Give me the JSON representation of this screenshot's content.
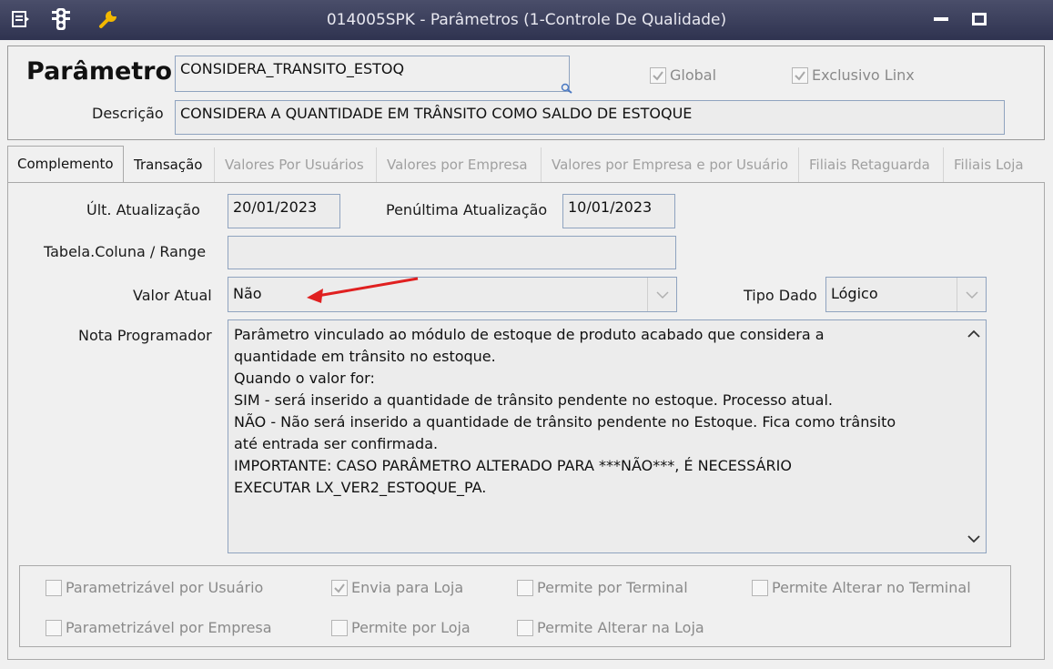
{
  "window": {
    "title": "014005SPK - Parâmetros (1-Controle De Qualidade)"
  },
  "header": {
    "param_label": "Parâmetro",
    "param_value": "CONSIDERA_TRANSITO_ESTOQ",
    "desc_label": "Descrição",
    "desc_value": "CONSIDERA A QUANTIDADE EM TRÂNSITO COMO SALDO DE ESTOQUE",
    "global_label": "Global",
    "global_checked": true,
    "exclusivo_label": "Exclusivo Linx",
    "exclusivo_checked": true
  },
  "tabs": [
    {
      "label": "Complemento",
      "state": "active"
    },
    {
      "label": "Transação",
      "state": "enabled"
    },
    {
      "label": "Valores Por Usuários",
      "state": "disabled"
    },
    {
      "label": "Valores por Empresa",
      "state": "disabled"
    },
    {
      "label": "Valores por Empresa e por Usuário",
      "state": "disabled"
    },
    {
      "label": "Filiais Retaguarda",
      "state": "disabled"
    },
    {
      "label": "Filiais Loja",
      "state": "disabled"
    }
  ],
  "complemento": {
    "ult_label": "Últ. Atualização",
    "ult_value": "20/01/2023",
    "pen_label": "Penúltima Atualização",
    "pen_value": "10/01/2023",
    "tabela_label": "Tabela.Coluna / Range",
    "tabela_value": "",
    "valor_label": "Valor Atual",
    "valor_value": "Não",
    "tipo_label": "Tipo Dado",
    "tipo_value": "Lógico",
    "nota_label": "Nota Programador",
    "nota_value": "Parâmetro vinculado ao módulo de estoque de produto acabado que considera a\nquantidade em trânsito no estoque.\nQuando o valor for:\nSIM - será inserido a quantidade de trânsito pendente no estoque. Processo atual.\nNÃO - Não será inserido a quantidade de trânsito pendente no Estoque. Fica como trânsito\naté entrada ser confirmada.\nIMPORTANTE: CASO PARÂMETRO ALTERADO PARA ***NÃO***, É NECESSÁRIO\nEXECUTAR LX_VER2_ESTOQUE_PA."
  },
  "options": [
    {
      "label": "Parametrizável por Usuário",
      "checked": false
    },
    {
      "label": "Envia para Loja",
      "checked": true
    },
    {
      "label": "Permite por Terminal",
      "checked": false
    },
    {
      "label": "Permite Alterar no Terminal",
      "checked": false
    },
    {
      "label": "Parametrizável por Empresa",
      "checked": false
    },
    {
      "label": "Permite por Loja",
      "checked": false
    },
    {
      "label": "Permite Alterar na Loja",
      "checked": false
    }
  ],
  "colors": {
    "titlebar": "#3a3e5a",
    "annotation_arrow": "#e02020",
    "field_border": "#8fa3bf"
  }
}
